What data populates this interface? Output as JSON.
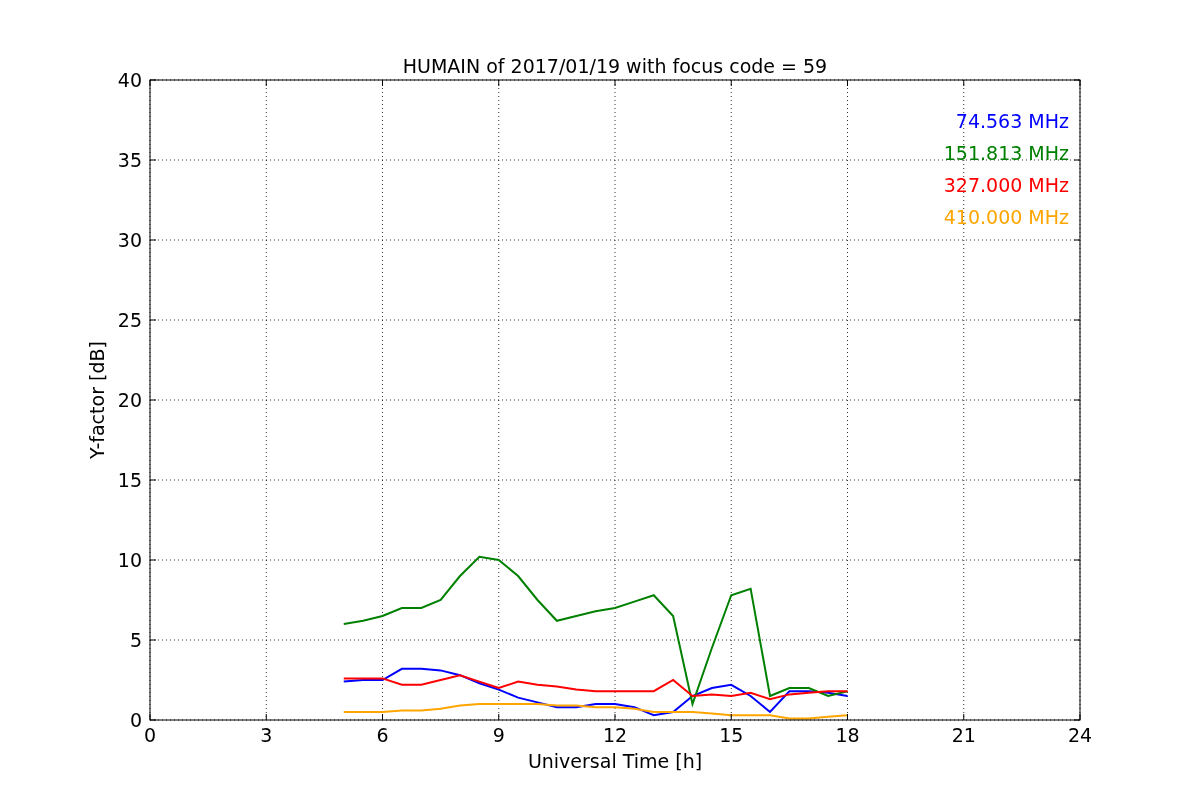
{
  "chart_data": {
    "type": "line",
    "title": "HUMAIN of 2017/01/19 with focus code = 59",
    "xlabel": "Universal Time [h]",
    "ylabel": "Y-factor [dB]",
    "x": [
      5,
      5.5,
      6,
      6.5,
      7,
      7.5,
      8,
      8.5,
      9,
      9.5,
      10,
      10.5,
      11,
      11.5,
      12,
      12.5,
      13,
      13.5,
      14,
      14.5,
      15,
      15.5,
      16,
      16.5,
      17,
      17.5,
      18
    ],
    "series": [
      {
        "name": "74.563 MHz",
        "color": "#0000ff",
        "values": [
          2.4,
          2.5,
          2.5,
          3.2,
          3.2,
          3.1,
          2.8,
          2.3,
          1.9,
          1.4,
          1.1,
          0.8,
          0.8,
          1.0,
          1.0,
          0.8,
          0.3,
          0.5,
          1.5,
          2.0,
          2.2,
          1.5,
          0.5,
          1.8,
          1.8,
          1.7,
          1.5
        ]
      },
      {
        "name": "151.813 MHz",
        "color": "#008000",
        "values": [
          6.0,
          6.2,
          6.5,
          7.0,
          7.0,
          7.5,
          9.0,
          10.2,
          10.0,
          9.0,
          7.5,
          6.2,
          6.5,
          6.8,
          7.0,
          7.4,
          7.8,
          6.5,
          1.0,
          4.5,
          7.8,
          8.2,
          1.5,
          2.0,
          2.0,
          1.5,
          1.8
        ]
      },
      {
        "name": "327.000 MHz",
        "color": "#ff0000",
        "values": [
          2.6,
          2.6,
          2.6,
          2.2,
          2.2,
          2.5,
          2.8,
          2.4,
          2.0,
          2.4,
          2.2,
          2.1,
          1.9,
          1.8,
          1.8,
          1.8,
          1.8,
          2.5,
          1.5,
          1.6,
          1.5,
          1.7,
          1.3,
          1.6,
          1.7,
          1.8,
          1.8
        ]
      },
      {
        "name": "410.000 MHz",
        "color": "#ffa500",
        "values": [
          0.5,
          0.5,
          0.5,
          0.6,
          0.6,
          0.7,
          0.9,
          1.0,
          1.0,
          1.0,
          1.0,
          0.9,
          0.9,
          0.8,
          0.8,
          0.7,
          0.5,
          0.5,
          0.5,
          0.4,
          0.3,
          0.3,
          0.3,
          0.1,
          0.1,
          0.2,
          0.3
        ]
      }
    ],
    "xlim": [
      0,
      24
    ],
    "ylim": [
      0,
      40
    ],
    "xticks": [
      0,
      3,
      6,
      9,
      12,
      15,
      18,
      21,
      24
    ],
    "yticks": [
      0,
      5,
      10,
      15,
      20,
      25,
      30,
      35,
      40
    ],
    "grid": true
  }
}
